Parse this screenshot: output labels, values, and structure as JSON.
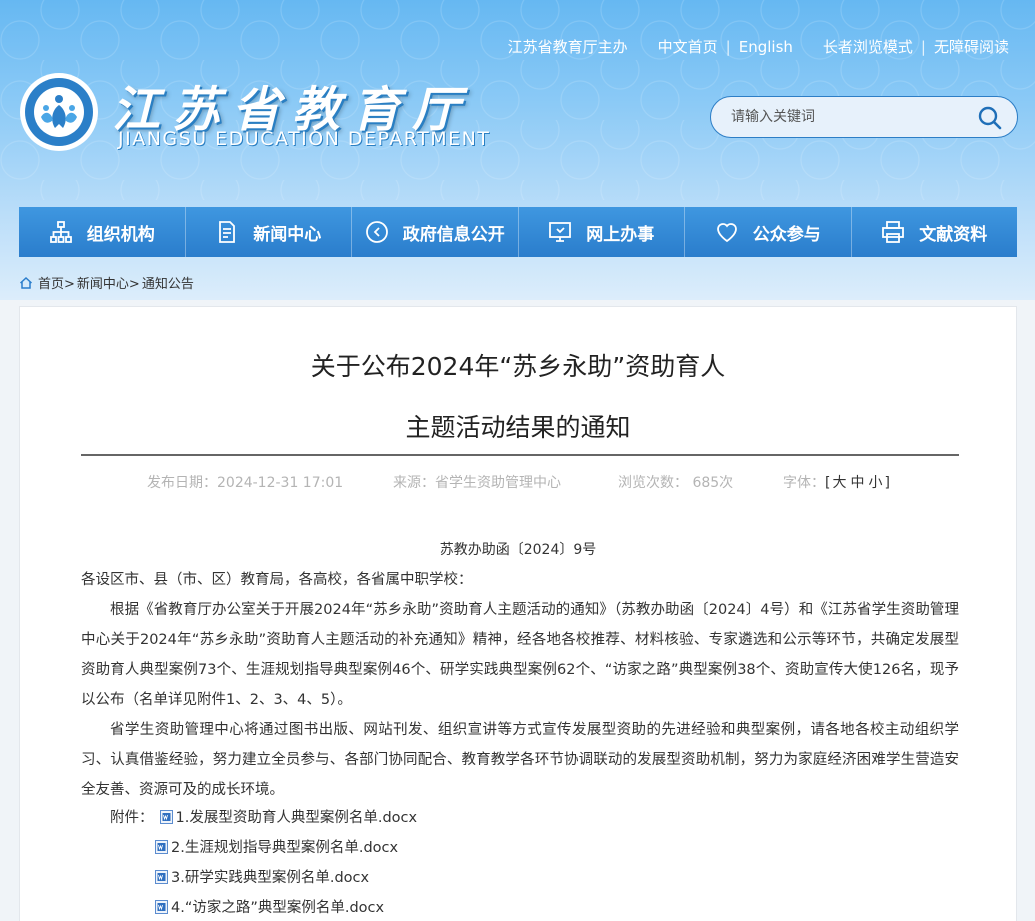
{
  "header": {
    "top_links": [
      "江苏省教育厅主办",
      "中文首页",
      "English",
      "长者浏览模式",
      "无障碍阅读"
    ],
    "site_title": "江苏省教育厅",
    "site_subtitle": "JIANGSU EDUCATION DEPARTMENT",
    "search": {
      "placeholder": "请输入关键词"
    }
  },
  "nav": [
    {
      "label": "组织机构",
      "icon": "org-chart-icon"
    },
    {
      "label": "新闻中心",
      "icon": "document-icon"
    },
    {
      "label": "政府信息公开",
      "icon": "arrow-circle-icon"
    },
    {
      "label": "网上办事",
      "icon": "monitor-icon"
    },
    {
      "label": "公众参与",
      "icon": "heart-icon"
    },
    {
      "label": "文献资料",
      "icon": "printer-icon"
    }
  ],
  "breadcrumb": [
    "首页>",
    "新闻中心>",
    "通知公告"
  ],
  "article": {
    "title_line1": "关于公布2024年“苏乡永助”资助育人",
    "title_line2": "主题活动结果的通知",
    "meta": {
      "date": "发布日期：2024-12-31 17:01",
      "source": "来源：省学生资助管理中心",
      "views": "浏览次数： 685次",
      "font_label": "字体：",
      "font_open": "[",
      "font_large": "大",
      "font_medium": "中",
      "font_small": "小",
      "font_close": "]"
    },
    "doc_no": "苏教办助函〔2024〕9号",
    "salutation": "各设区市、县（市、区）教育局，各高校，各省属中职学校：",
    "para1": "根据《省教育厅办公室关于开展2024年“苏乡永助”资助育人主题活动的通知》（苏教办助函〔2024〕4号）和《江苏省学生资助管理中心关于2024年“苏乡永助”资助育人主题活动的补充通知》精神，经各地各校推荐、材料核验、专家遴选和公示等环节，共确定发展型资助育人典型案例73个、生涯规划指导典型案例46个、研学实践典型案例62个、“访家之路”典型案例38个、资助宣传大使126名，现予以公布（名单详见附件1、2、3、4、5）。",
    "para2": "省学生资助管理中心将通过图书出版、网站刊发、组织宣讲等方式宣传发展型资助的先进经验和典型案例，请各地各校主动组织学习、认真借鉴经验，努力建立全员参与、各部门协同配合、教育教学各环节协调联动的发展型资助机制，努力为家庭经济困难学生营造安全友善、资源可及的成长环境。",
    "attach_label": "附件：",
    "attachments": [
      "1.发展型资助育人典型案例名单.docx",
      "2.生涯规划指导典型案例名单.docx",
      "3.研学实践典型案例名单.docx",
      "4.“访家之路”典型案例名单.docx"
    ]
  }
}
